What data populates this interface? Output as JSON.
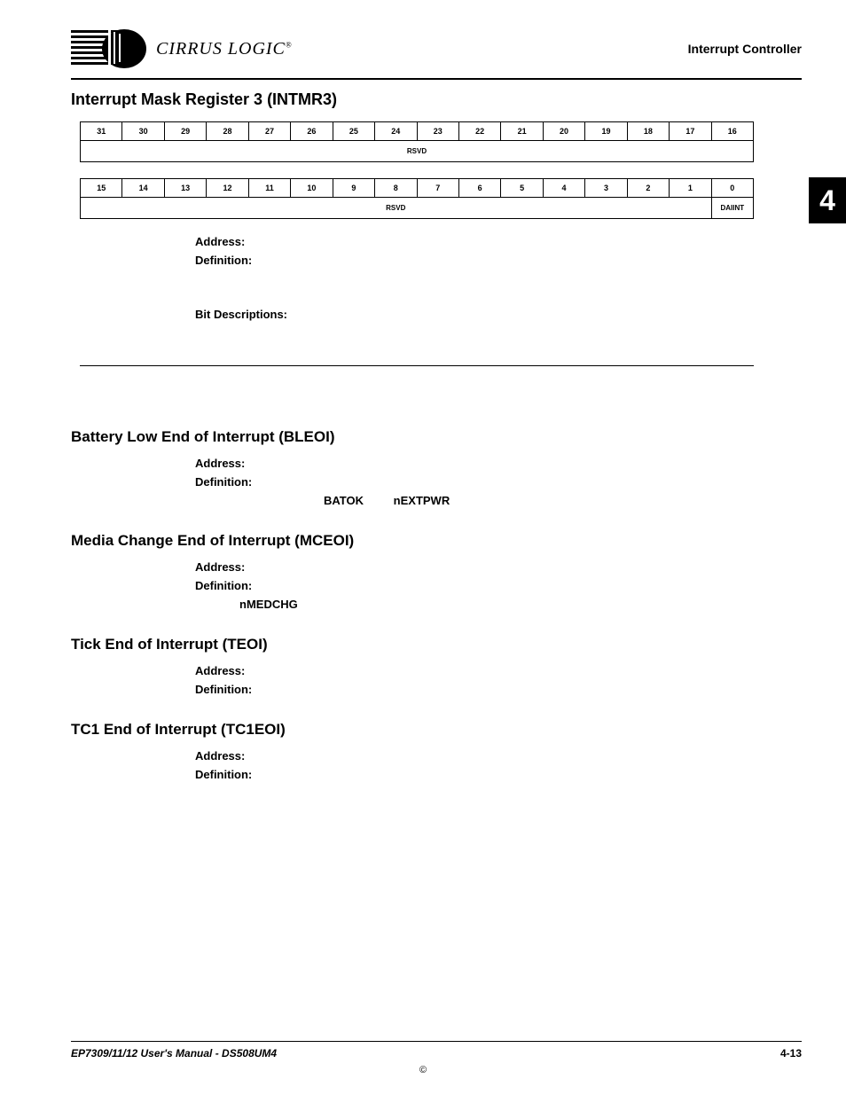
{
  "header": {
    "logo_text": "CIRRUS LOGIC",
    "logo_reg": "®",
    "right": "Interrupt Controller"
  },
  "side_tab": "4",
  "intmr3": {
    "title": "Interrupt Mask Register 3 (INTMR3)",
    "bits_high": [
      "31",
      "30",
      "29",
      "28",
      "27",
      "26",
      "25",
      "24",
      "23",
      "22",
      "21",
      "20",
      "19",
      "18",
      "17",
      "16"
    ],
    "row_high_label": "RSVD",
    "bits_low": [
      "15",
      "14",
      "13",
      "12",
      "11",
      "10",
      "9",
      "8",
      "7",
      "6",
      "5",
      "4",
      "3",
      "2",
      "1",
      "0"
    ],
    "row_low_rsvd": "RSVD",
    "row_low_daiint": "DAIINT",
    "address_label": "Address:",
    "definition_label": "Definition:",
    "bitdesc_label": "Bit Descriptions:"
  },
  "bleoi": {
    "title": "Battery Low End of Interrupt (BLEOI)",
    "address_label": "Address:",
    "definition_label": "Definition:",
    "kw1": "BATOK",
    "kw2": "nEXTPWR"
  },
  "mceoi": {
    "title": "Media Change End of Interrupt (MCEOI)",
    "address_label": "Address:",
    "definition_label": "Definition:",
    "kw1": "nMEDCHG"
  },
  "teoi": {
    "title": "Tick End of Interrupt (TEOI)",
    "address_label": "Address:",
    "definition_label": "Definition:"
  },
  "tc1eoi": {
    "title": "TC1 End of Interrupt (TC1EOI)",
    "address_label": "Address:",
    "definition_label": "Definition:"
  },
  "footer": {
    "left": "EP7309/11/12 User's Manual - DS508UM4",
    "right": "4-13",
    "copy": "©"
  }
}
